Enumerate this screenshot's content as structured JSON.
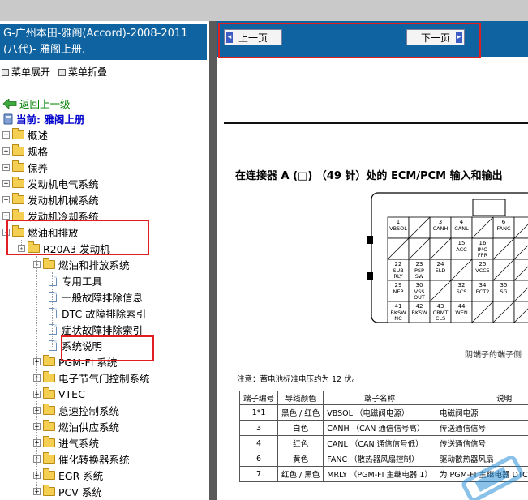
{
  "left": {
    "title": [
      "G-广州本田-雅阁(Accord)-2008-2011",
      "(八代)- 雅阁上册."
    ],
    "menu_expand": "菜单展开",
    "menu_collapse": "菜单折叠",
    "back_link": "返回上一级",
    "current": "当前: 雅阁上册",
    "tree": [
      {
        "label": "概述",
        "level": 0,
        "kind": "folder",
        "exp": "+"
      },
      {
        "label": "规格",
        "level": 0,
        "kind": "folder",
        "exp": "+"
      },
      {
        "label": "保养",
        "level": 0,
        "kind": "folder",
        "exp": "+"
      },
      {
        "label": "发动机电气系统",
        "level": 0,
        "kind": "folder",
        "exp": "+"
      },
      {
        "label": "发动机机械系统",
        "level": 0,
        "kind": "folder",
        "exp": "+"
      },
      {
        "label": "发动机冷却系统",
        "level": 0,
        "kind": "folder",
        "exp": "+"
      },
      {
        "label": "燃油和排放",
        "level": 0,
        "kind": "folder",
        "exp": "-"
      },
      {
        "label": "R20A3 发动机",
        "level": 1,
        "kind": "folder",
        "exp": "-"
      },
      {
        "label": "燃油和排放系统",
        "level": 2,
        "kind": "folder",
        "exp": "-"
      },
      {
        "label": "专用工具",
        "level": 3,
        "kind": "doc"
      },
      {
        "label": "一般故障排除信息",
        "level": 3,
        "kind": "doc"
      },
      {
        "label": "DTC 故障排除索引",
        "level": 3,
        "kind": "doc"
      },
      {
        "label": "症状故障排除索引",
        "level": 3,
        "kind": "doc"
      },
      {
        "label": "系统说明",
        "level": 3,
        "kind": "doc",
        "selected": true
      },
      {
        "label": "PGM-FI 系统",
        "level": 2,
        "kind": "folder",
        "exp": "+"
      },
      {
        "label": "电子节气门控制系统",
        "level": 2,
        "kind": "folder",
        "exp": "+"
      },
      {
        "label": "VTEC",
        "level": 2,
        "kind": "folder",
        "exp": "+"
      },
      {
        "label": "怠速控制系统",
        "level": 2,
        "kind": "folder",
        "exp": "+"
      },
      {
        "label": "燃油供应系统",
        "level": 2,
        "kind": "folder",
        "exp": "+"
      },
      {
        "label": "进气系统",
        "level": 2,
        "kind": "folder",
        "exp": "+"
      },
      {
        "label": "催化转换器系统",
        "level": 2,
        "kind": "folder",
        "exp": "+"
      },
      {
        "label": "EGR 系统",
        "level": 2,
        "kind": "folder",
        "exp": "+"
      },
      {
        "label": "PCV 系统",
        "level": 2,
        "kind": "folder",
        "exp": "+"
      }
    ]
  },
  "right": {
    "prev_button": "上一页",
    "next_button": "下一页",
    "doc_title": "在连接器 A (□) （49 针）处的 ECM/PCM 输入和输出",
    "connector_caption": "阴端子的端子侧",
    "connector_pins": [
      {
        "n": "1",
        "t": "VBSOL"
      },
      {
        "n": "3",
        "t": "CANH"
      },
      {
        "n": "4",
        "t": "CANL"
      },
      {
        "n": "6",
        "t": "FANC"
      },
      {
        "n": "15",
        "t": "ACC"
      },
      {
        "n": "16",
        "t": "IMO FPR"
      },
      {
        "n": "22",
        "t": "SUB RLY"
      },
      {
        "n": "23",
        "t": "PSP SW"
      },
      {
        "n": "24",
        "t": "ELD"
      },
      {
        "n": "25",
        "t": "VCC5"
      },
      {
        "n": "29",
        "t": "NEP"
      },
      {
        "n": "30",
        "t": "VSS OUT"
      },
      {
        "n": "32",
        "t": "SCS"
      },
      {
        "n": "34",
        "t": "ECT2"
      },
      {
        "n": "35",
        "t": "SG"
      },
      {
        "n": "41",
        "t": "BKSW NC"
      },
      {
        "n": "42",
        "t": "BKSW"
      },
      {
        "n": "43",
        "t": "CRMT CLS"
      },
      {
        "n": "44",
        "t": "WEN"
      }
    ],
    "note": "注意：蓄电池标准电压约为 12 伏。",
    "table": {
      "headers": [
        "端子编号",
        "导线颜色",
        "端子名称",
        "说明"
      ],
      "rows": [
        [
          "1*1",
          "黑色 / 红色",
          "VBSOL （电磁阀电源）",
          "电磁阀电源"
        ],
        [
          "3",
          "白色",
          "CANH （CAN 通信信号高）",
          "传送通信信号"
        ],
        [
          "4",
          "红色",
          "CANL （CAN 通信信号低）",
          "传送通信信号"
        ],
        [
          "6",
          "黄色",
          "FANC （散热器风扇控制）",
          "驱动散热器风扇"
        ],
        [
          "7",
          "红色 / 黑色",
          "MRLY （PGM-FI 主继电器 1）",
          "为 PGM-FI 主继电器 DTC 存储器电源"
        ]
      ]
    }
  },
  "colors": {
    "title_bar": "#0f63a0",
    "highlight": "#e02020",
    "link": "#008000",
    "current": "#0000cc"
  }
}
